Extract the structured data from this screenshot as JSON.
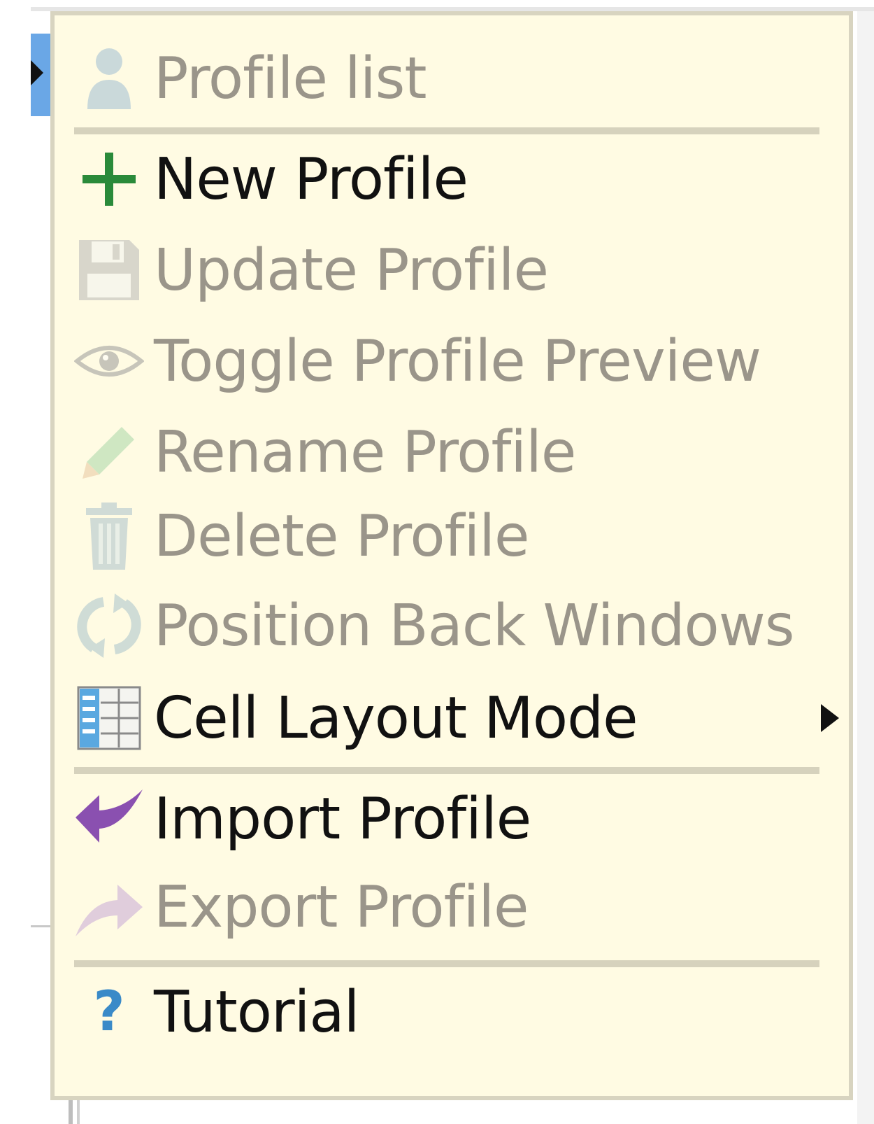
{
  "menu": {
    "header": {
      "label": "Profile list",
      "icon": "user-icon"
    },
    "items": [
      {
        "label": "New Profile",
        "icon": "plus-icon",
        "enabled": true
      },
      {
        "label": "Update Profile",
        "icon": "floppy-disk-icon",
        "enabled": false
      },
      {
        "label": "Toggle Profile Preview",
        "icon": "eye-icon",
        "enabled": false
      },
      {
        "label": "Rename Profile",
        "icon": "pencil-icon",
        "enabled": false
      },
      {
        "label": "Delete Profile",
        "icon": "trash-icon",
        "enabled": false
      },
      {
        "label": "Position Back Windows",
        "icon": "refresh-icon",
        "enabled": false
      },
      {
        "label": "Cell Layout Mode",
        "icon": "table-layout-icon",
        "enabled": true,
        "has_submenu": true
      },
      {
        "label": "Import Profile",
        "icon": "import-arrow-icon",
        "enabled": true
      },
      {
        "label": "Export Profile",
        "icon": "export-arrow-icon",
        "enabled": false
      },
      {
        "label": "Tutorial",
        "icon": "question-icon",
        "enabled": true
      }
    ]
  },
  "colors": {
    "menu_background": "#fffbe3",
    "plus_icon": "#2a8a3a",
    "import_icon": "#8a50b0",
    "help_icon": "#3a8ac8"
  }
}
